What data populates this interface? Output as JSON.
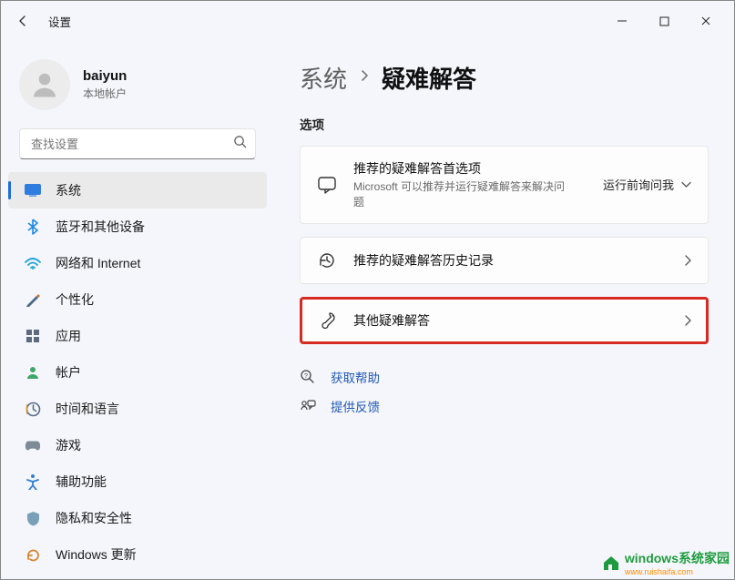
{
  "window": {
    "title": "设置"
  },
  "user": {
    "name": "baiyun",
    "subtitle": "本地帐户"
  },
  "search": {
    "placeholder": "查找设置"
  },
  "sidebar": {
    "items": [
      {
        "label": "系统",
        "icon": "system"
      },
      {
        "label": "蓝牙和其他设备",
        "icon": "bluetooth"
      },
      {
        "label": "网络和 Internet",
        "icon": "network"
      },
      {
        "label": "个性化",
        "icon": "personalize"
      },
      {
        "label": "应用",
        "icon": "apps"
      },
      {
        "label": "帐户",
        "icon": "account"
      },
      {
        "label": "时间和语言",
        "icon": "time"
      },
      {
        "label": "游戏",
        "icon": "gaming"
      },
      {
        "label": "辅助功能",
        "icon": "accessibility"
      },
      {
        "label": "隐私和安全性",
        "icon": "privacy"
      },
      {
        "label": "Windows 更新",
        "icon": "update"
      }
    ]
  },
  "content": {
    "breadcrumb_root": "系统",
    "breadcrumb_current": "疑难解答",
    "section_label": "选项",
    "card1": {
      "title": "推荐的疑难解答首选项",
      "subtitle": "Microsoft 可以推荐并运行疑难解答来解决问题",
      "select_label": "运行前询问我"
    },
    "card2": {
      "title": "推荐的疑难解答历史记录"
    },
    "card3": {
      "title": "其他疑难解答"
    },
    "help_link": "获取帮助",
    "feedback_link": "提供反馈"
  },
  "watermark": {
    "brand": "windows系统家园",
    "url": "www.ruishaifa.com"
  }
}
